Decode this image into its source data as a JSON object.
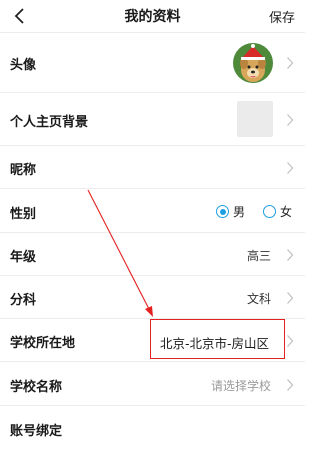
{
  "header": {
    "title": "我的资料",
    "save_label": "保存"
  },
  "rows": {
    "avatar": {
      "label": "头像"
    },
    "background": {
      "label": "个人主页背景"
    },
    "nickname": {
      "label": "昵称",
      "value": ""
    },
    "gender": {
      "label": "性别",
      "options": {
        "male": "男",
        "female": "女"
      },
      "selected": "男"
    },
    "grade": {
      "label": "年级",
      "value": "高三"
    },
    "subject": {
      "label": "分科",
      "value": "文科"
    },
    "school_location": {
      "label": "学校所在地",
      "value": "北京-北京市-房山区"
    },
    "school_name": {
      "label": "学校名称",
      "placeholder": "请选择学校"
    },
    "account_binding": {
      "label": "账号绑定"
    }
  },
  "colors": {
    "accent": "#1e9fe0",
    "annotation": "#e3211f",
    "divider": "#ededed",
    "placeholder": "#9a9a9a"
  },
  "icons": {
    "back": "chevron-left-icon",
    "row_arrow": "chevron-right-icon"
  }
}
